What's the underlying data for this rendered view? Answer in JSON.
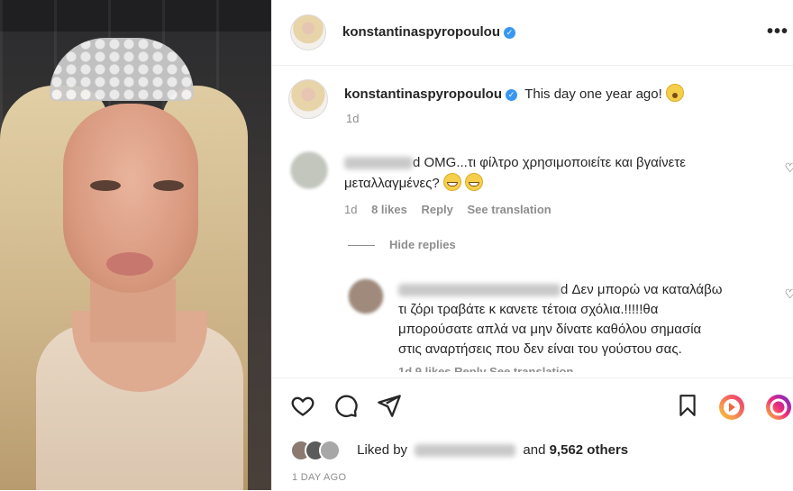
{
  "post": {
    "username": "konstantinaspyropoulou",
    "more_label": "•••",
    "caption": "This day one year ago!",
    "caption_age": "1d"
  },
  "comments": [
    {
      "text_line1": "d OMG...τι φίλτρο χρησιμοποιείτε και βγαίνετε",
      "text_line2": "μεταλλαγμένες?",
      "age": "1d",
      "likes": "8 likes",
      "reply": "Reply",
      "translate": "See translation"
    }
  ],
  "hide_replies": "Hide replies",
  "reply_comment": {
    "line1": "d Δεν μπορώ να καταλάβω",
    "line2": "τι ζόρι τραβάτε κ κανετε τέτοια σχόλια.!!!!!θα",
    "line3": "μπορούσατε απλά να μην δίνατε καθόλου σημασία",
    "line4": "στις αναρτήσεις που δεν είναι του γούστου σας.",
    "meta": "1d   9 likes   Reply   See translation"
  },
  "likes_bar": {
    "prefix": "Liked by",
    "middle": "and",
    "count": "9,562 others"
  },
  "date": "1 DAY AGO",
  "colors": {
    "verified": "#3897f0",
    "reels_gradient_start": "#f9ce34",
    "reels_gradient_end": "#ee2a7b",
    "meta_gray": "#8e8e8e"
  },
  "icons": [
    "heart-icon",
    "comment-icon",
    "share-icon",
    "bookmark-icon",
    "reels-icon",
    "instagram-icon",
    "verified-icon",
    "more-icon"
  ]
}
